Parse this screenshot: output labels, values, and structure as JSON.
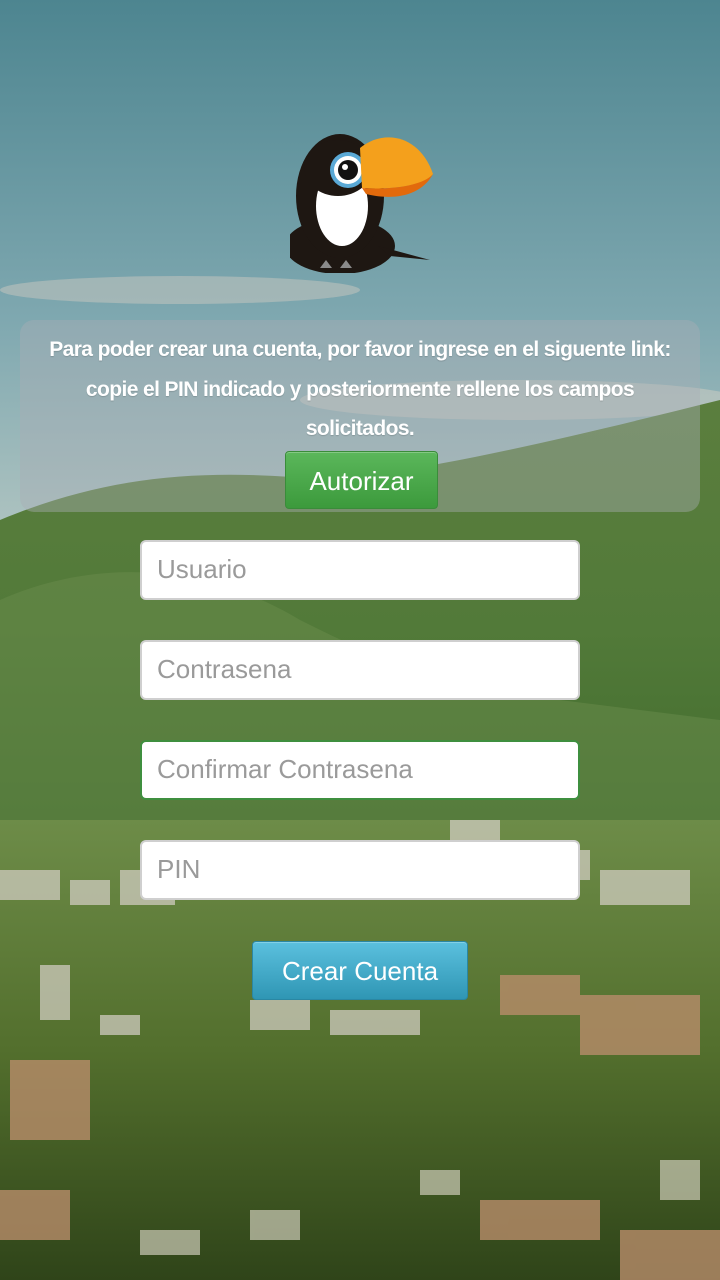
{
  "logo": {
    "icon": "toucan-logo-icon"
  },
  "info": {
    "line1": "Para poder crear una cuenta, por favor ingrese en el siguente link:",
    "line2": "copie el PIN indicado y posteriormente rellene los campos",
    "line3": "solicitados."
  },
  "buttons": {
    "authorize_label": "Autorizar",
    "create_label": "Crear Cuenta"
  },
  "form": {
    "username_placeholder": "Usuario",
    "password_placeholder": "Contrasena",
    "confirm_placeholder": "Confirmar Contrasena",
    "pin_placeholder": "PIN"
  },
  "colors": {
    "authorize_button": "#4cae4c",
    "create_button": "#3fa9cc",
    "focused_field_border": "#3f8f3f"
  }
}
